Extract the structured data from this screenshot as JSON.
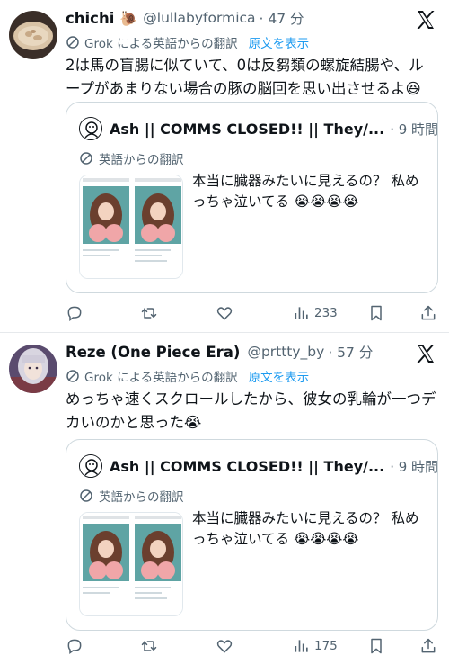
{
  "posts": [
    {
      "name": "chichi",
      "name_emoji": "🐌",
      "handle": "@lullabyformica",
      "time": "· 47 分",
      "translate_label": "Grok による英語からの翻訳",
      "show_original": "原文を表示",
      "body": "2は馬の盲腸に似ていて、0は反芻類の螺旋結腸や、ループがあまりない場合の豚の脳回を思い出させるよ😆",
      "quote": {
        "name": "Ash || COMMS CLOSED!! || They/...",
        "time": "· 9 時間",
        "translate_label": "英語からの翻訳",
        "text": "本当に臓器みたいに見えるの？ 私めっちゃ泣いてる 😭😭😭😭"
      },
      "actions": {
        "views": "233"
      }
    },
    {
      "name": "Reze (One Piece Era)",
      "handle": "@prttty_by",
      "time": "· 57 分",
      "translate_label": "Grok による英語からの翻訳",
      "show_original": "原文を表示",
      "body": "めっちゃ速くスクロールしたから、彼女の乳輪が一つデカいのかと思った😭",
      "quote": {
        "name": "Ash || COMMS CLOSED!! || They/...",
        "time": "· 9 時間",
        "translate_label": "英語からの翻訳",
        "text": "本当に臓器みたいに見えるの？ 私めっちゃ泣いてる 😭😭😭😭"
      },
      "actions": {
        "views": "175"
      }
    }
  ],
  "icons": {
    "x_logo": "x-logo-icon",
    "translate": "translate-icon",
    "reply": "reply-icon",
    "repost": "repost-icon",
    "like": "like-icon",
    "views": "views-icon",
    "bookmark": "bookmark-icon",
    "share": "share-icon"
  },
  "colors": {
    "text": "#0f1419",
    "secondary": "#536471",
    "link": "#1d9bf0",
    "border": "#cfd9de"
  }
}
